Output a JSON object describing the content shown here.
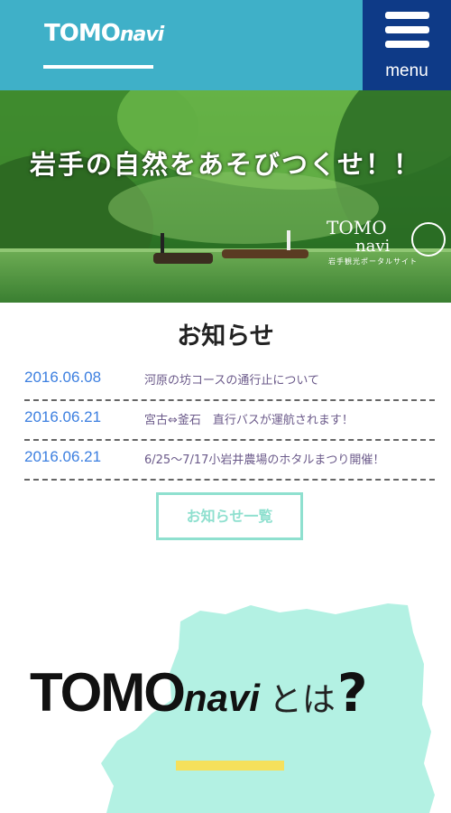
{
  "header": {
    "logo_main": "TOMO",
    "logo_sub": "navi",
    "menu_label": "menu"
  },
  "hero": {
    "title": "岩手の自然をあそびつくせ！！",
    "watermark_main": "TOMO",
    "watermark_sub": "navi",
    "watermark_caption": "岩手観光ポータルサイト"
  },
  "news": {
    "heading": "お知らせ",
    "items": [
      {
        "date": "2016.06.08",
        "text": "河原の坊コースの通行止について"
      },
      {
        "date": "2016.06.21",
        "text": "宮古⇔釜石　直行バスが運航されます！"
      },
      {
        "date": "2016.06.21",
        "text": "6/25〜7/17小岩井農場のホタルまつり開催！"
      }
    ],
    "list_button": "お知らせ一覧"
  },
  "about": {
    "title_main": "TOMO",
    "title_sub": "navi",
    "title_suffix": "とは",
    "title_q": "?"
  },
  "colors": {
    "header_bg": "#3fb0c8",
    "menu_bg": "#0e3a87",
    "date_blue": "#3c7fe0",
    "button_mint": "#8fe0cf",
    "map_mint": "#b3f1e3",
    "accent_yellow": "#f5e05c"
  },
  "icons": {
    "menu": "hamburger-icon"
  }
}
